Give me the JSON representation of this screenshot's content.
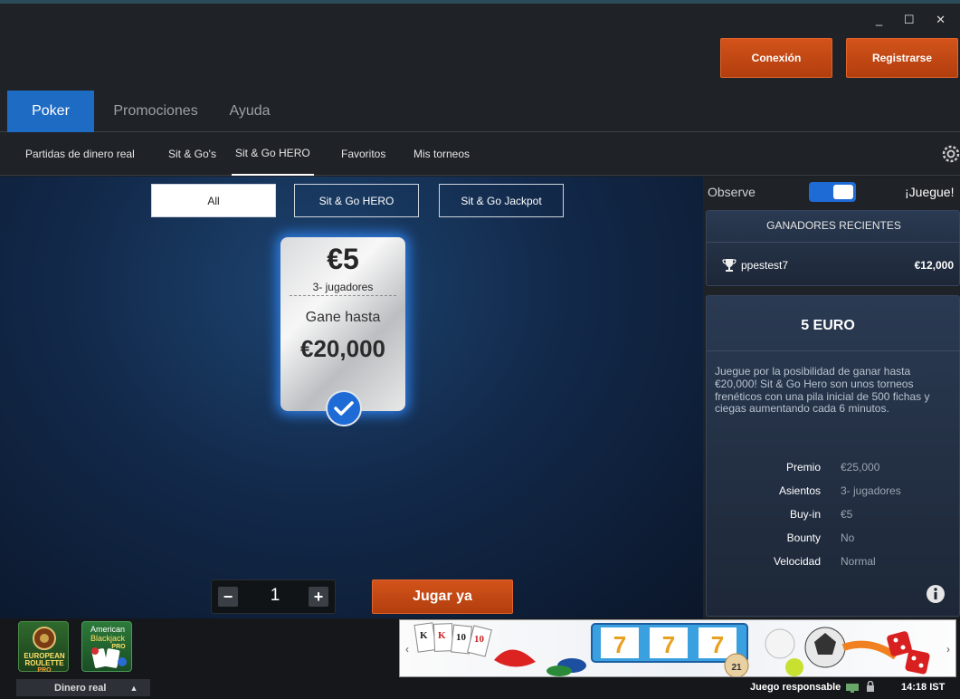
{
  "window": {
    "controls": "_ ☐ ✕"
  },
  "header": {
    "login_label": "Conexión",
    "register_label": "Registrarse"
  },
  "main_tabs": [
    {
      "label": "Poker",
      "active": true
    },
    {
      "label": "Promociones",
      "active": false
    },
    {
      "label": "Ayuda",
      "active": false
    }
  ],
  "sub_tabs": [
    {
      "label": "Partidas de dinero real",
      "active": false
    },
    {
      "label": "Sit & Go's",
      "active": false
    },
    {
      "label": "Sit & Go HERO",
      "active": true
    },
    {
      "label": "Favoritos",
      "active": false
    },
    {
      "label": "Mis torneos",
      "active": false
    }
  ],
  "filters": [
    {
      "label": "All",
      "active": true
    },
    {
      "label": "Sit & Go HERO",
      "active": false
    },
    {
      "label": "Sit & Go Jackpot",
      "active": false
    }
  ],
  "card": {
    "buyin": "€5",
    "players": "3- jugadores",
    "win_label": "Gane hasta",
    "prize": "€20,000",
    "selected": true
  },
  "stepper": {
    "minus": "−",
    "value": "1",
    "plus": "+"
  },
  "play_button": "Jugar ya",
  "side": {
    "observe_label": "Observe",
    "observe_on": true,
    "play_label": "¡Juegue!",
    "recent_winners_title": "GANADORES RECIENTES",
    "winners": [
      {
        "name": "ppestest7",
        "amount": "€12,000"
      }
    ],
    "info": {
      "title": "5 EURO",
      "description": "Juegue por la posibilidad de ganar hasta €20,000! Sit & Go Hero son unos torneos frenéticos con una pila inicial de 500 fichas y ciegas aumentando cada 6 minutos.",
      "details": [
        {
          "label": "Premio",
          "value": "€25,000"
        },
        {
          "label": "Asientos",
          "value": "3- jugadores"
        },
        {
          "label": "Buy-in",
          "value": "€5"
        },
        {
          "label": "Bounty",
          "value": "No"
        },
        {
          "label": "Velocidad",
          "value": "Normal"
        }
      ]
    }
  },
  "footer": {
    "games": [
      {
        "name": "EUROPEAN ROULETTE PRO"
      },
      {
        "name": "American Blackjack PRO"
      }
    ],
    "money_mode": "Dinero real",
    "responsible": "Juego responsable",
    "time": "14:18 IST"
  },
  "colors": {
    "accent": "#1e6bc4",
    "orange": "#c8491a",
    "panel": "#1f2226"
  }
}
